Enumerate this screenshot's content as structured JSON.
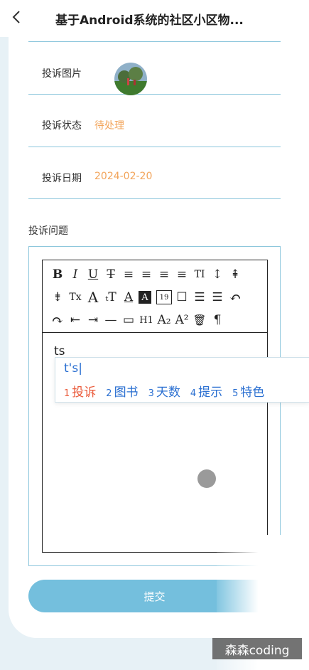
{
  "header": {
    "title": "基于Android系统的社区小区物..."
  },
  "form": {
    "image_label": "投诉图片",
    "status_label": "投诉状态",
    "status_value": "待处理",
    "date_label": "投诉日期",
    "date_value": "2024-02-20",
    "question_label": "投诉问题"
  },
  "editor": {
    "toolbar_row1": [
      "B",
      "I",
      "U",
      "T",
      "≡",
      "≡",
      "≡",
      "≡",
      "TI",
      "↕",
      "⇞"
    ],
    "toolbar_row2": [
      "⇟",
      "Tx",
      "A",
      "ₜT",
      "A",
      "A",
      "19",
      "☐",
      "☰",
      "☰",
      "↶"
    ],
    "toolbar_row3": [
      "↷",
      "⇤",
      "⇥",
      "—",
      "▭",
      "H1",
      "A₂",
      "A²",
      "🗑",
      "¶"
    ],
    "content": "ts"
  },
  "ime": {
    "composition": "t's",
    "candidates": [
      {
        "num": "1",
        "text": "投诉"
      },
      {
        "num": "2",
        "text": "图书"
      },
      {
        "num": "3",
        "text": "天数"
      },
      {
        "num": "4",
        "text": "提示"
      },
      {
        "num": "5",
        "text": "特色"
      }
    ]
  },
  "submit_label": "提交",
  "watermark": "森森coding",
  "colors": {
    "accent": "#74bfdd",
    "status": "#f2a45a",
    "ime_active": "#ea5a3a",
    "ime_text": "#2a6fd1"
  }
}
